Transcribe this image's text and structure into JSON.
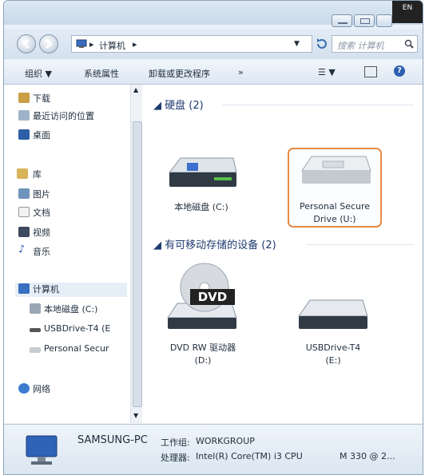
{
  "titlebar": {
    "lang_indicator": "EN"
  },
  "address": {
    "root_label": "计算机"
  },
  "search": {
    "placeholder": "搜索 计算机"
  },
  "toolbar": {
    "organize": "组织 ▼",
    "system_properties": "系统属性",
    "uninstall": "卸载或更改程序",
    "more": "»"
  },
  "navigation": {
    "items": [
      {
        "label": "下载",
        "icon": "downloads-folder-icon"
      },
      {
        "label": "最近访问的位置",
        "icon": "recent-places-icon"
      },
      {
        "label": "桌面",
        "icon": "desktop-icon"
      },
      {
        "label": "库",
        "icon": "libraries-icon"
      },
      {
        "label": "图片",
        "icon": "pictures-icon"
      },
      {
        "label": "文档",
        "icon": "documents-icon"
      },
      {
        "label": "视频",
        "icon": "videos-icon"
      },
      {
        "label": "音乐",
        "icon": "music-icon"
      },
      {
        "label": "计算机",
        "icon": "computer-icon",
        "selected": true
      },
      {
        "label": "本地磁盘 (C:)",
        "icon": "local-disk-icon"
      },
      {
        "label": "USBDrive-T4 (E",
        "icon": "usb-drive-icon"
      },
      {
        "label": "Personal Secur",
        "icon": "secure-drive-icon"
      },
      {
        "label": "网络",
        "icon": "network-icon"
      }
    ]
  },
  "content": {
    "hard_disks": {
      "title": "硬盘 (2)",
      "items": [
        {
          "label": "本地磁盘 (C:)",
          "icon": "local-disk-drive-icon"
        },
        {
          "label_line1": "Personal Secure",
          "label_line2": "Drive (U:)",
          "icon": "secure-drive-drive-icon",
          "selected": true
        }
      ]
    },
    "removable": {
      "title": "有可移动存储的设备 (2)",
      "items": [
        {
          "label_line1": "DVD RW 驱动器",
          "label_line2": "(D:)",
          "icon": "dvd-drive-icon",
          "badge": "DVD"
        },
        {
          "label_line1": "USBDrive-T4",
          "label_line2": "(E:)",
          "icon": "usb-drive-drive-icon"
        }
      ]
    }
  },
  "status": {
    "computer_name": "SAMSUNG-PC",
    "workgroup_label": "工作组:",
    "workgroup": "WORKGROUP",
    "processor_label": "处理器:",
    "processor": "Intel(R) Core(TM) i3 CPU",
    "processor_model": "M 330  @ 2..."
  },
  "colors": {
    "selection_border": "#e58a43",
    "group_title": "#1e3a6e",
    "window_bg": "#eaf1f8"
  }
}
